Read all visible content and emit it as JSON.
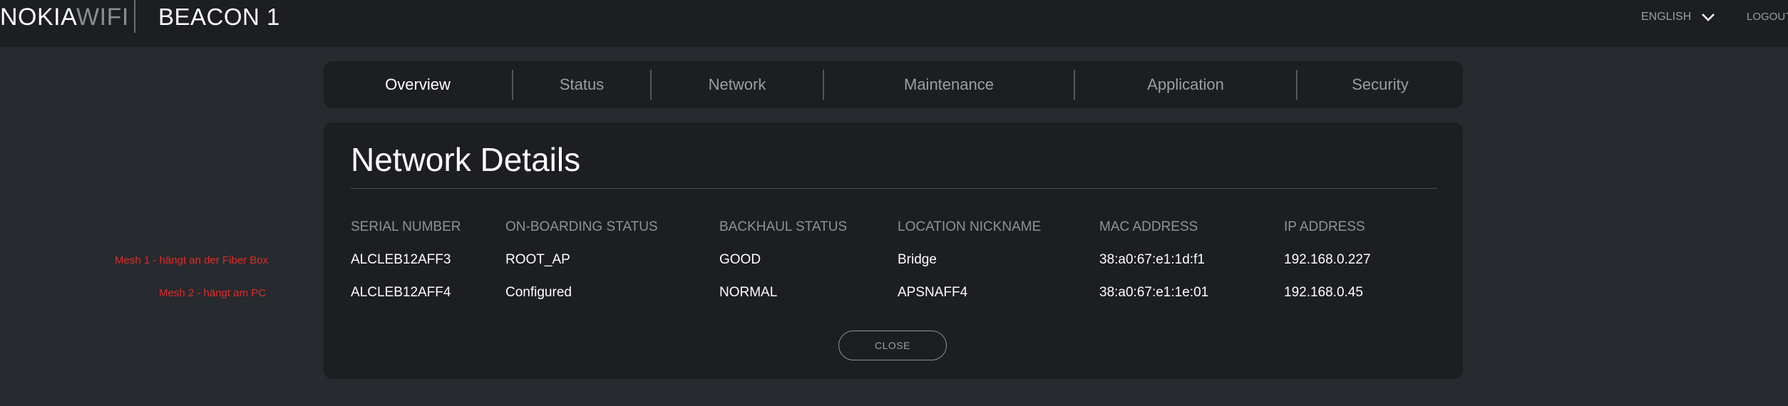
{
  "header": {
    "logo_part1": "NOKIA",
    "logo_part2": "WIFI",
    "device_title": "BEACON 1",
    "language": "ENGLISH",
    "language_icon": "chevron-down-icon",
    "logout": "LOGOUT"
  },
  "nav": {
    "tabs": [
      {
        "label": "Overview",
        "active": true
      },
      {
        "label": "Status",
        "active": false
      },
      {
        "label": "Network",
        "active": false
      },
      {
        "label": "Maintenance",
        "active": false
      },
      {
        "label": "Application",
        "active": false
      },
      {
        "label": "Security",
        "active": false
      }
    ]
  },
  "details": {
    "title": "Network Details",
    "columns": [
      "SERIAL NUMBER",
      "ON-BOARDING STATUS",
      "BACKHAUL STATUS",
      "LOCATION NICKNAME",
      "MAC ADDRESS",
      "IP ADDRESS"
    ],
    "rows": [
      [
        "ALCLEB12AFF3",
        "ROOT_AP",
        "GOOD",
        "Bridge",
        "38:a0:67:e1:1d:f1",
        "192.168.0.227"
      ],
      [
        "ALCLEB12AFF4",
        "Configured",
        "NORMAL",
        "APSNAFF4",
        "38:a0:67:e1:1e:01",
        "192.168.0.45"
      ]
    ],
    "close_label": "CLOSE"
  },
  "annotations": {
    "row1": "Mesh 1 - hängt an der Fiber Box",
    "row2": "Mesh 2 - hängt am PC"
  },
  "colors": {
    "page_bg": "#272a2e",
    "panel_bg": "#1c1e21",
    "muted_text": "#9b9ea2",
    "annotation_red": "#e02b2b"
  }
}
